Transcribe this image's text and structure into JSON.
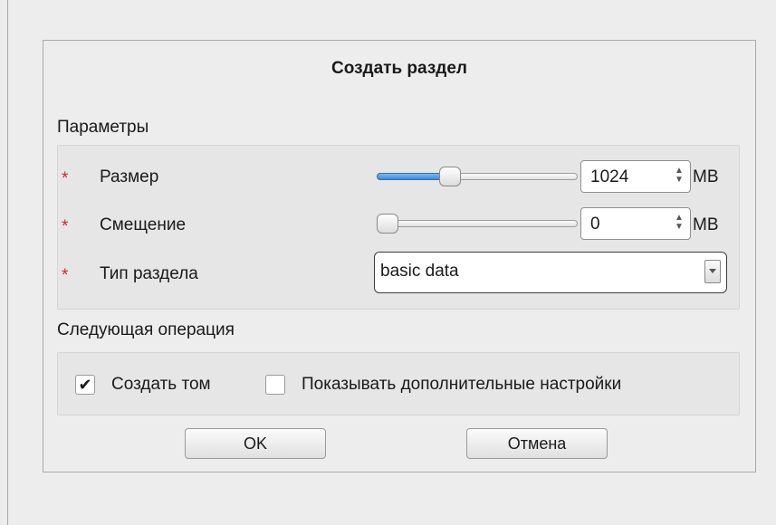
{
  "dialog": {
    "title": "Создать раздел"
  },
  "parameters": {
    "section_label": "Параметры",
    "required_marker": "*",
    "size": {
      "label": "Размер",
      "value": "1024",
      "unit": "MB",
      "slider_level_fraction": 0.35
    },
    "offset": {
      "label": "Смещение",
      "value": "0",
      "unit": "MB",
      "slider_level_fraction": 0.0
    },
    "partition_type": {
      "label": "Тип раздела",
      "value": "basic data"
    }
  },
  "next_operation": {
    "section_label": "Следующая операция",
    "create_volume": {
      "label": "Создать том",
      "checked": true
    },
    "show_advanced": {
      "label": "Показывать дополнительные настройки",
      "checked": false
    }
  },
  "buttons": {
    "ok_label": "OK",
    "cancel_label": "Отмена"
  },
  "icons": {
    "checkmark": "✔",
    "spin_up": "▲",
    "spin_down": "▼"
  },
  "colors": {
    "required_marker": "#d62525",
    "slider_fill": "#3d8ad8"
  }
}
